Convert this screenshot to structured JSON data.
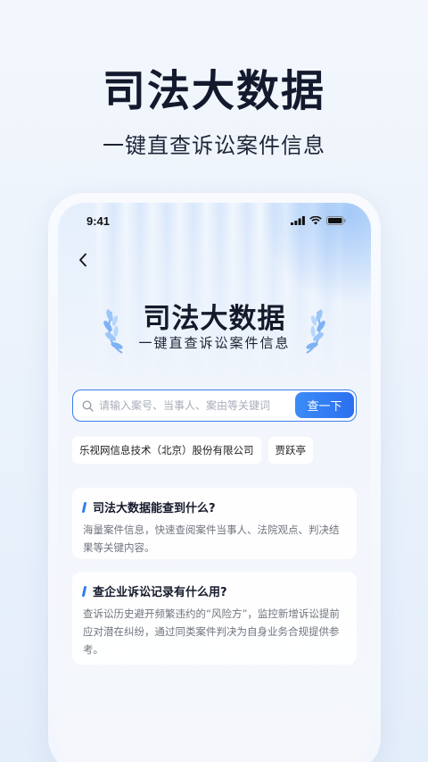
{
  "promo": {
    "title": "司法大数据",
    "subtitle": "一键直查诉讼案件信息"
  },
  "status_bar": {
    "time": "9:41"
  },
  "hero": {
    "title": "司法大数据",
    "subtitle": "一键直查诉讼案件信息"
  },
  "search": {
    "placeholder": "请输入案号、当事人、案由等关键词",
    "button_label": "查一下"
  },
  "chips": [
    "乐视网信息技术（北京）股份有限公司",
    "贾跃亭"
  ],
  "faq": [
    {
      "question": "司法大数据能查到什么?",
      "answer": "海量案件信息，快速查阅案件当事人、法院观点、判决结果等关键内容。"
    },
    {
      "question": "查企业诉讼记录有什么用?",
      "answer": "查诉讼历史避开频繁违约的“风险方”，监控新增诉讼提前应对潜在纠纷，通过同类案件判决为自身业务合规提供参考。"
    }
  ],
  "colors": {
    "accent": "#2f7cf2",
    "title": "#141a2e",
    "body_text": "#70747d"
  },
  "icons": {
    "back": "chevron-left-icon",
    "search": "search-icon",
    "signal": "signal-icon",
    "wifi": "wifi-icon",
    "battery": "battery-icon"
  }
}
